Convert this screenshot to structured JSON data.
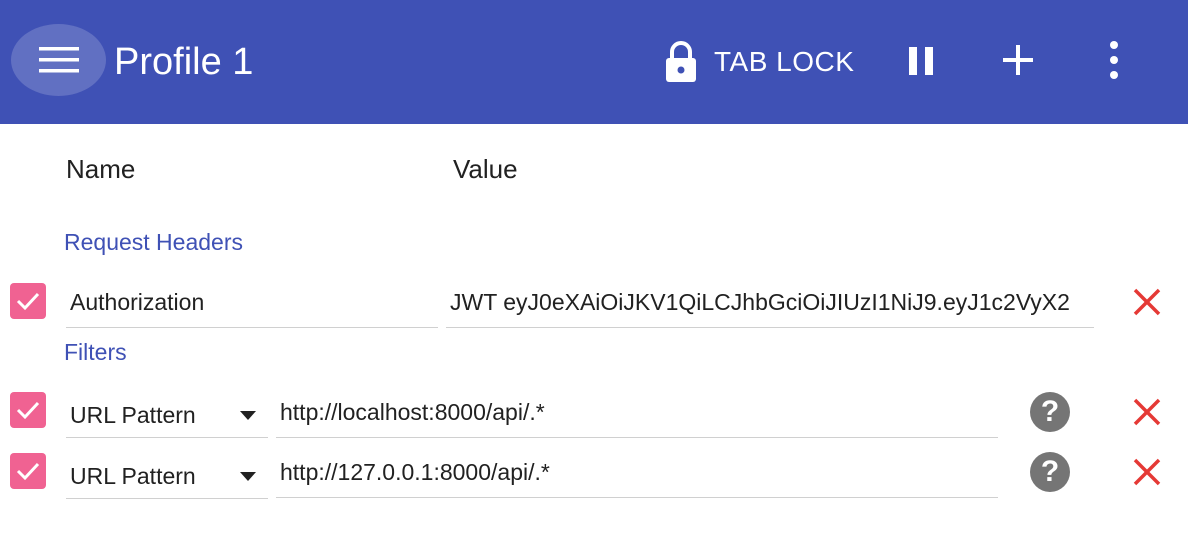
{
  "header": {
    "title": "Profile 1",
    "tab_lock_label": "TAB LOCK",
    "icons": {
      "menu": "menu-icon",
      "lock": "lock-icon",
      "pause": "pause-icon",
      "add": "add-icon",
      "more": "more-vert-icon"
    },
    "colors": {
      "bar": "#3f51b5"
    }
  },
  "columns": {
    "name": "Name",
    "value": "Value"
  },
  "request_headers": {
    "section_label": "Request Headers",
    "items": [
      {
        "enabled": true,
        "name": "Authorization",
        "value": "JWT eyJ0eXAiOiJKV1QiLCJhbGciOiJIUzI1NiJ9.eyJ1c2VyX2"
      }
    ]
  },
  "filters": {
    "section_label": "Filters",
    "items": [
      {
        "enabled": true,
        "type": "URL Pattern",
        "value": "http://localhost:8000/api/.*"
      },
      {
        "enabled": true,
        "type": "URL Pattern",
        "value": "http://127.0.0.1:8000/api/.*"
      }
    ]
  },
  "colors": {
    "accent": "#3f51b5",
    "checkbox": "#f06292",
    "delete": "#e53935",
    "help": "#757575"
  }
}
